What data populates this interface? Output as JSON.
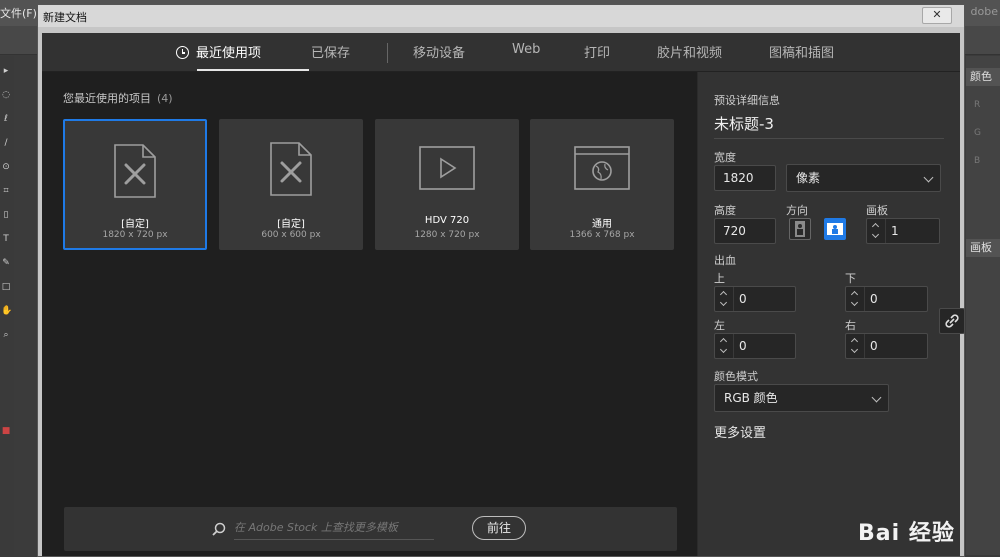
{
  "app": {
    "menu_label": "文件(F)",
    "brand_fragment": "dobe",
    "right_tabs": [
      "颜色",
      "画板"
    ],
    "right_letters": [
      "R",
      "G",
      "B"
    ]
  },
  "dialog": {
    "title": "新建文档",
    "close_label": "✕"
  },
  "tabs": [
    {
      "label": "最近使用项",
      "active": true
    },
    {
      "label": "已保存",
      "active": false
    },
    {
      "label": "移动设备",
      "active": false
    },
    {
      "label": "Web",
      "active": false
    },
    {
      "label": "打印",
      "active": false
    },
    {
      "label": "胶片和视频",
      "active": false
    },
    {
      "label": "图稿和插图",
      "active": false
    }
  ],
  "recent": {
    "heading": "您最近使用的项目",
    "count": "(4)",
    "items": [
      {
        "name": "[自定]",
        "size": "1820 x 720 px",
        "icon": "custom-document-icon",
        "selected": true
      },
      {
        "name": "[自定]",
        "size": "600 x 600 px",
        "icon": "custom-document-icon",
        "selected": false
      },
      {
        "name": "HDV 720",
        "size": "1280 x 720 px",
        "icon": "video-play-icon",
        "selected": false
      },
      {
        "name": "通用",
        "size": "1366 x 768 px",
        "icon": "web-globe-icon",
        "selected": false
      }
    ]
  },
  "stock_search": {
    "placeholder": "在 Adobe Stock 上查找更多模板",
    "button": "前往"
  },
  "details": {
    "heading": "预设详细信息",
    "doc_name": "未标题-3",
    "width_label": "宽度",
    "width_value": "1820",
    "unit": "像素",
    "height_label": "高度",
    "height_value": "720",
    "orientation_label": "方向",
    "orientation": "landscape",
    "artboards_label": "画板",
    "artboards_value": "1",
    "bleed_label": "出血",
    "bleed_top_label": "上",
    "bleed_top": "0",
    "bleed_bottom_label": "下",
    "bleed_bottom": "0",
    "bleed_left_label": "左",
    "bleed_left": "0",
    "bleed_right_label": "右",
    "bleed_right": "0",
    "color_mode_label": "颜色模式",
    "color_mode": "RGB 颜色",
    "more_settings": "更多设置"
  },
  "watermark": "Bai 经验",
  "colors": {
    "accent": "#1f7ae6",
    "dialog_bg": "#2b2b2b",
    "panel_bg": "#333333"
  }
}
